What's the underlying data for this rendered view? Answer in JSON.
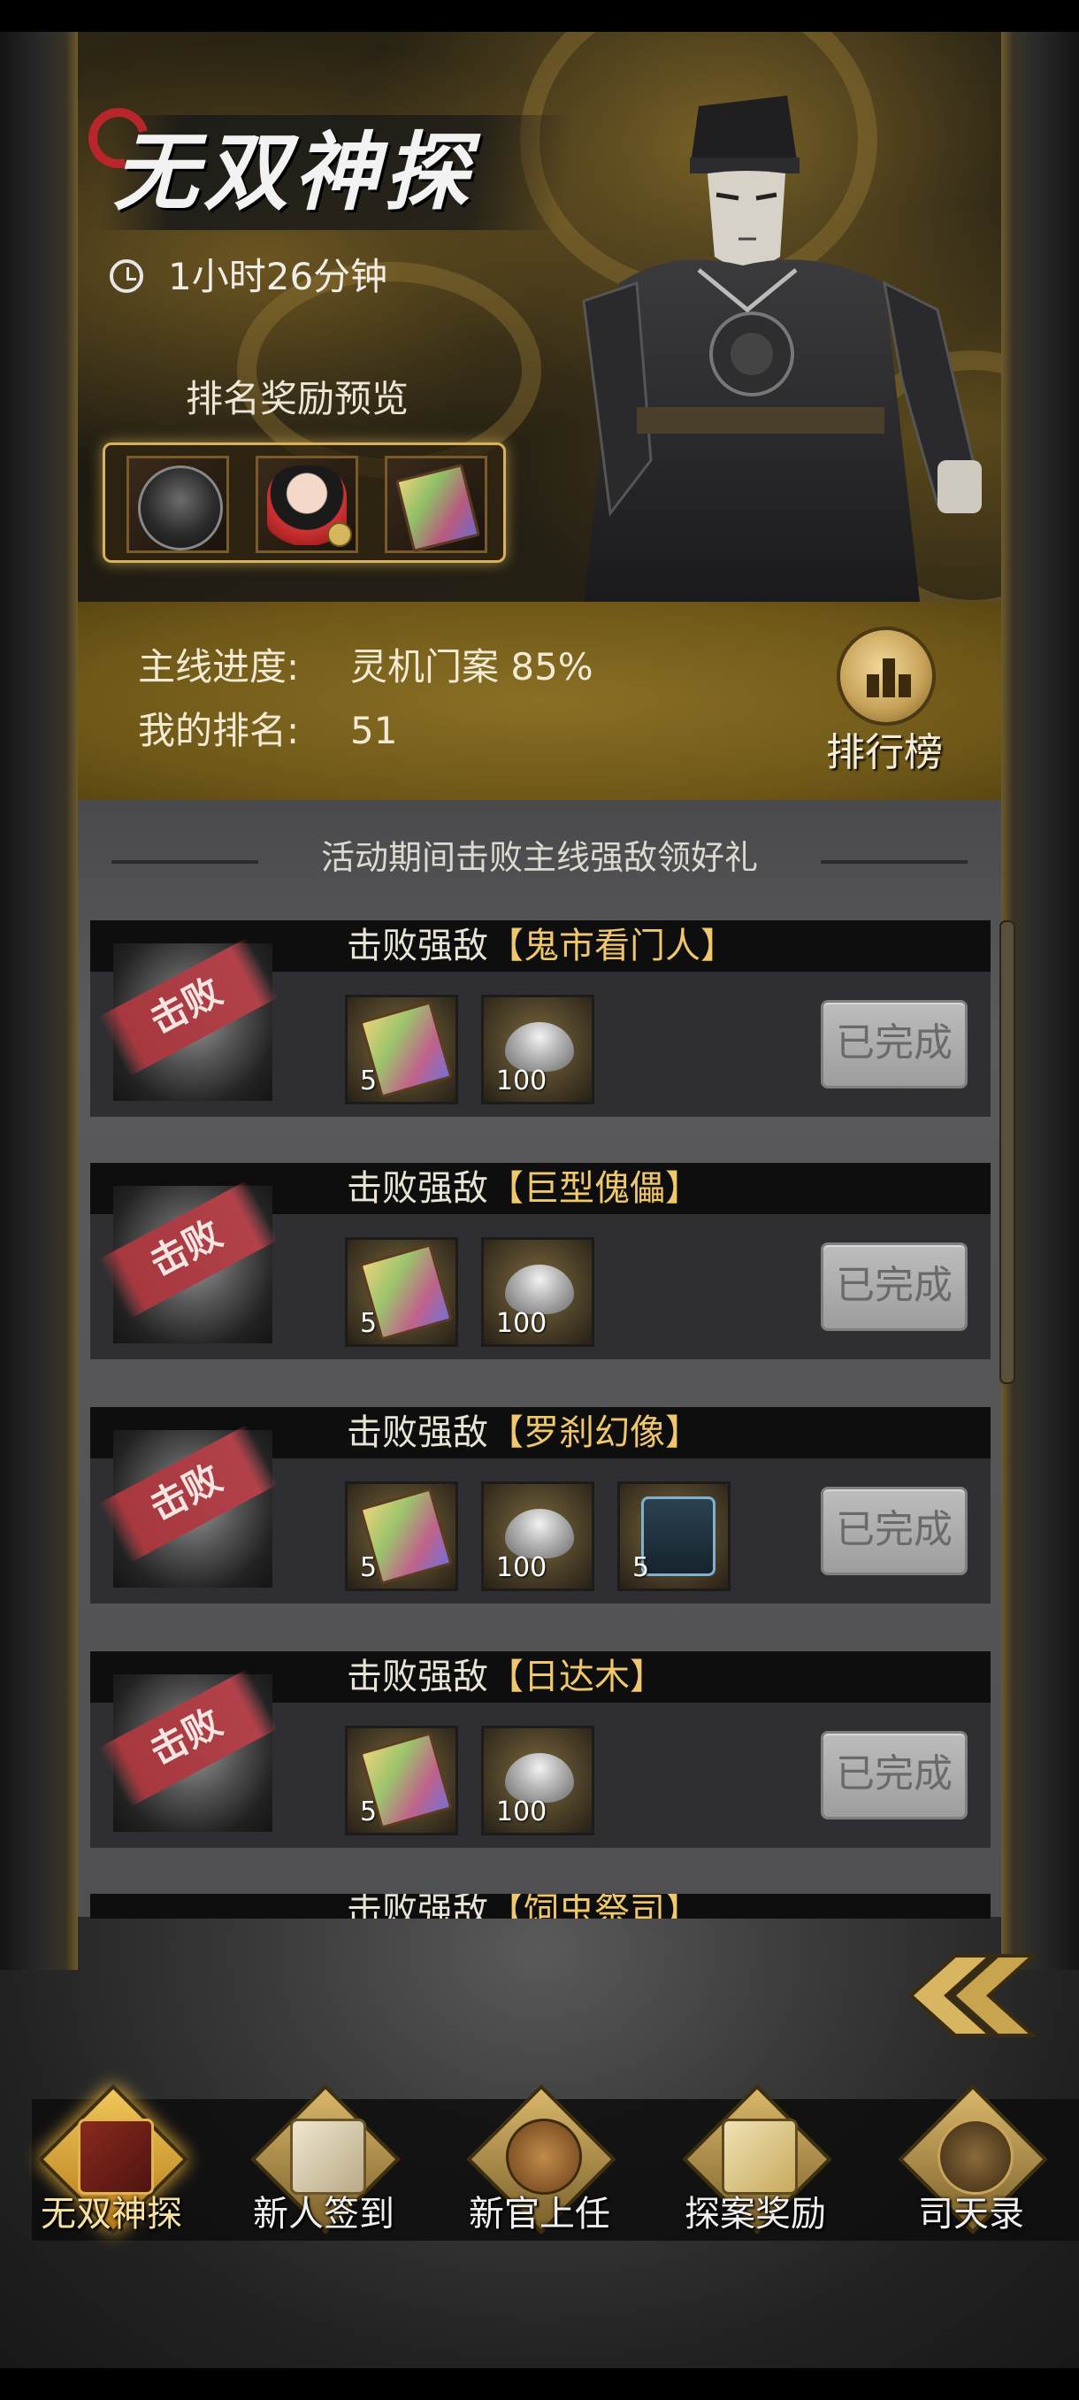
{
  "event": {
    "title": "无双神探",
    "timer": "1小时26分钟",
    "rank_preview_label": "排名奖励预览"
  },
  "progress": {
    "mainline_label": "主线进度:",
    "mainline_value": "灵机门案 85%",
    "rank_label": "我的排名:",
    "rank_value": "51",
    "leaderboard_label": "排行榜"
  },
  "hint": "活动期间击败主线强敌领好礼",
  "defeated_stamp": "击败",
  "tasks": [
    {
      "prefix": "击败强敌",
      "name": "【鬼市看门人】",
      "status": "已完成",
      "rewards": [
        {
          "icon": "review-book-icon",
          "count": "5"
        },
        {
          "icon": "silver-ingot-icon",
          "count": "100"
        }
      ]
    },
    {
      "prefix": "击败强敌",
      "name": "【巨型傀儡】",
      "status": "已完成",
      "rewards": [
        {
          "icon": "review-book-icon",
          "count": "5"
        },
        {
          "icon": "silver-ingot-icon",
          "count": "100"
        }
      ]
    },
    {
      "prefix": "击败强敌",
      "name": "【罗刹幻像】",
      "status": "已完成",
      "rewards": [
        {
          "icon": "review-book-icon",
          "count": "5"
        },
        {
          "icon": "silver-ingot-icon",
          "count": "100"
        },
        {
          "icon": "promotion-token-icon",
          "count": "5"
        }
      ]
    },
    {
      "prefix": "击败强敌",
      "name": "【日达木】",
      "status": "已完成",
      "rewards": [
        {
          "icon": "review-book-icon",
          "count": "5"
        },
        {
          "icon": "silver-ingot-icon",
          "count": "100"
        }
      ]
    },
    {
      "prefix": "击败强敌",
      "name": "【饲虫祭司】"
    }
  ],
  "nav": [
    {
      "label": "无双神探",
      "icon": "detective-badge-icon",
      "active": true
    },
    {
      "label": "新人签到",
      "icon": "scroll-book-icon",
      "active": false
    },
    {
      "label": "新官上任",
      "icon": "lion-statue-icon",
      "active": false
    },
    {
      "label": "探案奖励",
      "icon": "gift-box-icon",
      "active": false
    },
    {
      "label": "司天录",
      "icon": "astrolabe-icon",
      "active": false
    }
  ],
  "colors": {
    "accent_gold": "#d8b15a",
    "name_highlight": "#f0c76a",
    "stamp_red": "#b2414a",
    "completed_button": "#adadad"
  }
}
